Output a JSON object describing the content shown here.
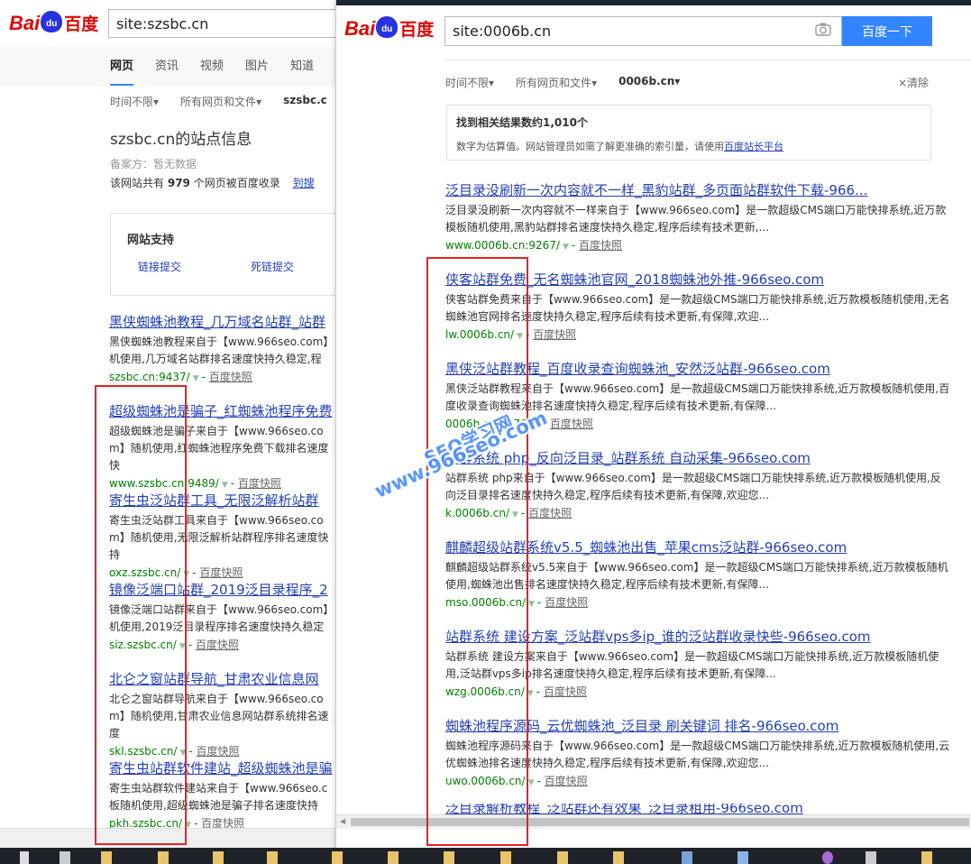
{
  "colors": {
    "link": "#2440b3",
    "url": "#008000",
    "accent": "#3385ff",
    "logo_red": "#e10601",
    "logo_blue": "#2932e1",
    "annotation": "#e52222",
    "watermark": "#4a8cff"
  },
  "left": {
    "logo": {
      "bai": "Bai",
      "du": "du",
      "cn": "百度"
    },
    "search_value": "site:szsbc.cn",
    "tabs": [
      "网页",
      "资讯",
      "视频",
      "图片",
      "知道"
    ],
    "filters": [
      "时间不限",
      "所有网页和文件",
      "szsbc.c"
    ],
    "filter_arrow": "▾",
    "site_info": {
      "title": "szsbc.cn的站点信息",
      "record": "备案方：暂无数据",
      "count_prefix": "该网站共有",
      "count": "979",
      "count_suffix": "个网页被百度收录",
      "link": "到搜"
    },
    "support": {
      "heading": "网站支持",
      "link1": "链接提交",
      "link2": "死链提交"
    },
    "results": [
      {
        "title": "黑侠蜘蛛池教程_几万域名站群_站群",
        "desc": "黑侠蜘蛛池教程来自于【www.966seo.com】机使用,几万域名站群排名速度快持久稳定,程",
        "url": "szsbc.cn:9437/"
      },
      {
        "title": "超级蜘蛛池是骗子_红蜘蛛池程序免费",
        "desc": "超级蜘蛛池是骗子来自于【www.966seo.com】随机使用,红蜘蛛池程序免费下载排名速度快",
        "url": "www.szsbc.cn:9489/"
      },
      {
        "title": "寄生虫泛站群工具_无限泛解析站群",
        "desc": "寄生虫泛站群工具来自于【www.966seo.com】随机使用,无限泛解析站群程序排名速度快持",
        "url": "oxz.szsbc.cn/"
      },
      {
        "title": "镜像泛端口站群_2019泛目录程序_2",
        "desc": "镜像泛端口站群来自于【www.966seo.com】机使用,2019泛目录程序排名速度快持久稳定",
        "url": "siz.szsbc.cn/"
      },
      {
        "title": "北仑之窗站群导航_甘肃农业信息网",
        "desc": "北仑之窗站群导航来自于【www.966seo.com】随机使用,甘肃农业信息网站群系统排名速度",
        "url": "skl.szsbc.cn/"
      },
      {
        "title": "寄生虫站群软件建站_超级蜘蛛池是骗",
        "desc": "寄生虫站群软件建站来自于【www.966seo.c板随机使用,超级蜘蛛池是骗子排名速度快持",
        "url": "pkh.szsbc.cn/"
      }
    ]
  },
  "snapshot_label": "百度快照",
  "right": {
    "logo": {
      "bai": "Bai",
      "du": "du",
      "cn": "百度"
    },
    "search_value": "site:0006b.cn",
    "camera_icon": "camera-icon",
    "search_button": "百度一下",
    "filters": [
      "时间不限",
      "所有网页和文件",
      "0006b.cn"
    ],
    "filter_arrow": "▾",
    "clear": "×清除",
    "count_line": "找到相关结果数约1,010个",
    "note_prefix": "数字为估算值。网站管理员如需了解更准确的索引量，请使用",
    "note_link": "百度站长平台",
    "results": [
      {
        "title": "泛目录没刷新一次内容就不一样_黑豹站群_多页面站群软件下载-966...",
        "desc": "泛目录没刷新一次内容就不一样来自于【www.966seo.com】是一款超级CMS端口万能快排系统,近万款模板随机使用,黑豹站群排名速度快持久稳定,程序后续有技术更新,...",
        "url": "www.0006b.cn:9267/"
      },
      {
        "title": "侠客站群免费_无名蜘蛛池官网_2018蜘蛛池外推-966seo.com",
        "desc": "侠客站群免费来自于【www.966seo.com】是一款超级CMS端口万能快排系统,近万款模板随机使用,无名蜘蛛池官网排名速度快持久稳定,程序后续有技术更新,有保障,欢迎...",
        "url": "lw.0006b.cn/"
      },
      {
        "title": "黑侠泛站群教程_百度收录查询蜘蛛池_安然泛站群-966seo.com",
        "desc": "黑侠泛站群教程来自于【www.966seo.com】是一款超级CMS端口万能快排系统,近万款模板随机使用,百度收录查询蜘蛛池排名速度快持久稳定,程序后续有技术更新,有保障...",
        "url": "0006b.cn:9076/"
      },
      {
        "title": "站群系统 php_反向泛目录_站群系统 自动采集-966seo.com",
        "desc": "站群系统 php来自于【www.966seo.com】是一款超级CMS端口万能快排系统,近万款模板随机使用,反向泛目录排名速度快持久稳定,程序后续有技术更新,有保障,欢迎您...",
        "url": "k.0006b.cn/"
      },
      {
        "title": "麒麟超级站群系统v5.5_蜘蛛池出售_苹果cms泛站群-966seo.com",
        "desc": "麒麟超级站群系统v5.5来自于【www.966seo.com】是一款超级CMS端口万能快排系统,近万款模板随机使用,蜘蛛池出售排名速度快持久稳定,程序后续有技术更新,有保障...",
        "url": "mso.0006b.cn/"
      },
      {
        "title": "站群系统 建设方案_泛站群vps多ip_谁的泛站群收录快些-966seo.com",
        "desc": "站群系统 建设方案来自于【www.966seo.com】是一款超级CMS端口万能快排系统,近万款模板随机使用,泛站群vps多ip排名速度快持久稳定,程序后续有技术更新,有保障...",
        "url": "wzg.0006b.cn/"
      },
      {
        "title": "蜘蛛池程序源码_云优蜘蛛池_泛目录 刷关键词 排名-966seo.com",
        "desc": "蜘蛛池程序源码来自于【www.966seo.com】是一款超级CMS端口万能快排系统,近万款模板随机使用,云优蜘蛛池排名速度快持久稳定,程序后续有技术更新,有保障,欢迎您...",
        "url": "uwo.0006b.cn/"
      },
      {
        "title": "泛目录解析教程_泛站群还有效果_泛目录租用-966seo.com",
        "desc": "",
        "url": ""
      }
    ]
  },
  "watermark": {
    "line1": "SEO学习网",
    "line2": "www.966seo.com"
  }
}
